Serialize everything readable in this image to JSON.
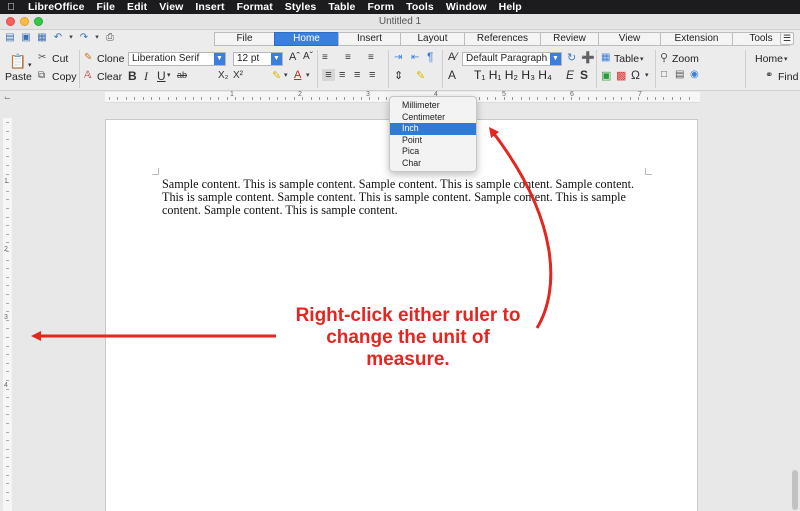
{
  "menubar": {
    "app": "LibreOffice",
    "items": [
      "File",
      "Edit",
      "View",
      "Insert",
      "Format",
      "Styles",
      "Table",
      "Form",
      "Tools",
      "Window",
      "Help"
    ]
  },
  "window": {
    "title": "Untitled 1"
  },
  "tabs": [
    {
      "label": "File",
      "w": 60
    },
    {
      "label": "Home",
      "w": 64
    },
    {
      "label": "Insert",
      "w": 62
    },
    {
      "label": "Layout",
      "w": 64
    },
    {
      "label": "References",
      "w": 76
    },
    {
      "label": "Review",
      "w": 58
    },
    {
      "label": "View",
      "w": 62
    },
    {
      "label": "Extension",
      "w": 72
    },
    {
      "label": "Tools",
      "w": 58
    }
  ],
  "active_tab": "Home",
  "toolbar": {
    "paste": "Paste",
    "cut": "Cut",
    "copy": "Copy",
    "clone": "Clone",
    "clear": "Clear",
    "font_name": "Liberation Serif",
    "font_size": "12 pt",
    "paragraph_style": "Default Paragraph St",
    "table": "Table",
    "zoom": "Zoom",
    "home_dropdown": "Home",
    "find": "Find",
    "bold": "B",
    "italic": "I",
    "underline": "U",
    "strike": "ab",
    "subscript": "X₂",
    "superscript": "X²",
    "heading_buttons": "T₁ H₁ H₂ H₃ H₄",
    "emphasis": "E",
    "strong": "S"
  },
  "ruler": {
    "h_numbers": [
      "1",
      "2",
      "3",
      "4",
      "5",
      "6",
      "7"
    ],
    "v_numbers": [
      "1",
      "2",
      "3",
      "4"
    ]
  },
  "context_menu": {
    "items": [
      "Millimeter",
      "Centimeter",
      "Inch",
      "Point",
      "Pica",
      "Char"
    ],
    "selected": "Inch"
  },
  "document": {
    "text": "Sample content. This is sample content. Sample content. This is sample content. Sample content. This is sample content. Sample content. This is sample content. Sample content. This is sample content. Sample content. This is sample content."
  },
  "annotation": {
    "line1": "Right-click either ruler to",
    "line2": "change the unit of",
    "line3": "measure."
  },
  "colors": {
    "accent": "#3b7fde",
    "annotation": "#e3261f"
  }
}
